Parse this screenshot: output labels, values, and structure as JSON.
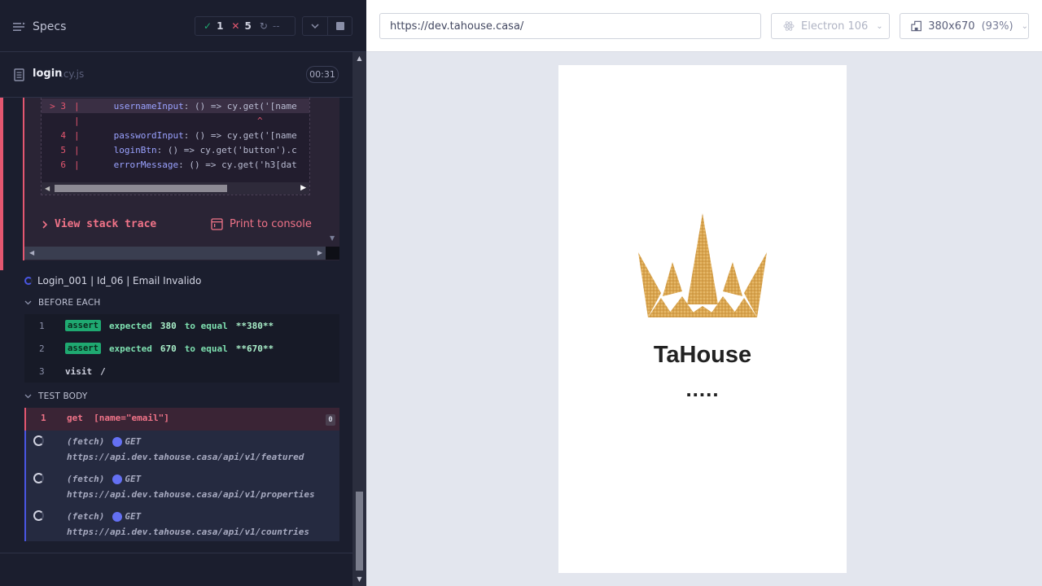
{
  "reporter": {
    "specs_label": "Specs",
    "stats": {
      "passed": "1",
      "failed": "5",
      "pending": "--"
    },
    "spec_file": {
      "name": "login",
      "ext": ".cy.js",
      "duration": "00:31"
    },
    "code_frame": [
      {
        "line": "> 3",
        "code_prop": "usernameInput",
        "code_rest": ": () => cy.get('[name",
        "highlight": true
      },
      {
        "line": "",
        "code_prop": "",
        "code_rest": "",
        "highlight": false,
        "caret": "^"
      },
      {
        "line": "4",
        "code_prop": "passwordInput",
        "code_rest": ": () => cy.get('[name",
        "highlight": false
      },
      {
        "line": "5",
        "code_prop": "loginBtn",
        "code_rest": ": () => cy.get('button').c",
        "highlight": false
      },
      {
        "line": "6",
        "code_prop": "errorMessage",
        "code_rest": ": () => cy.get('h3[dat",
        "highlight": false
      }
    ],
    "view_stack_trace": "View stack trace",
    "print_to_console": "Print to console",
    "test_title": "Login_001 | Id_06 | Email Invalido",
    "before_each_label": "BEFORE EACH",
    "before_each_cmds": [
      {
        "idx": "1",
        "name": "assert",
        "text_a": "expected",
        "num1": "380",
        "text_b": "to equal",
        "num2": "**380**"
      },
      {
        "idx": "2",
        "name": "assert",
        "text_a": "expected",
        "num1": "670",
        "text_b": "to equal",
        "num2": "**670**"
      },
      {
        "idx": "3",
        "name": "visit",
        "arg": "/"
      }
    ],
    "test_body_label": "TEST BODY",
    "get_cmd": {
      "idx": "1",
      "name": "get",
      "arg": "[name=\"email\"]",
      "count": "0"
    },
    "fetches": [
      {
        "label": "(fetch)",
        "method": "GET",
        "url": "https://api.dev.tahouse.casa/api/v1/featured"
      },
      {
        "label": "(fetch)",
        "method": "GET",
        "url": "https://api.dev.tahouse.casa/api/v1/properties"
      },
      {
        "label": "(fetch)",
        "method": "GET",
        "url": "https://api.dev.tahouse.casa/api/v1/countries"
      }
    ]
  },
  "aut": {
    "url": "https://dev.tahouse.casa/",
    "browser": "Electron 106",
    "viewport": "380x670",
    "scale": "(93%)",
    "brand_name": "TaHouse",
    "loading_dots": "....."
  },
  "colors": {
    "fail": "#e45770",
    "pass": "#1fa971",
    "accent": "#4956e3",
    "crown_gold": "#d9a44e"
  }
}
